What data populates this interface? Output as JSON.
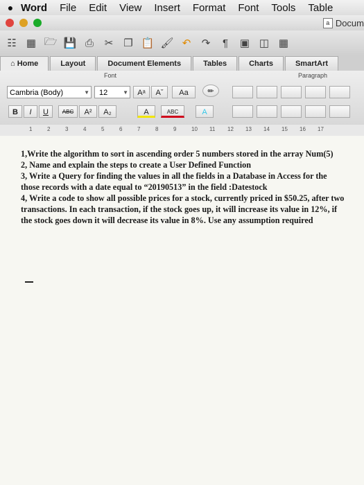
{
  "menubar": {
    "app_name": "Word",
    "items": [
      "File",
      "Edit",
      "View",
      "Insert",
      "Format",
      "Font",
      "Tools",
      "Table"
    ]
  },
  "window": {
    "document_title": "Docum",
    "doc_icon_glyph": "a"
  },
  "ribbon": {
    "tabs": [
      {
        "label": "Home",
        "active": true
      },
      {
        "label": "Layout",
        "active": false
      },
      {
        "label": "Document Elements",
        "active": false
      },
      {
        "label": "Tables",
        "active": false
      },
      {
        "label": "Charts",
        "active": false
      },
      {
        "label": "SmartArt",
        "active": false
      }
    ],
    "font_group_label": "Font",
    "paragraph_group_label": "Paragraph",
    "font_name": "Cambria (Body)",
    "font_size": "12",
    "buttons": {
      "grow": "Aᵃ",
      "shrink": "Aˇ",
      "case": "Aa",
      "bold": "B",
      "italic": "I",
      "underline": "U",
      "strike": "ABC",
      "superscript": "A²",
      "subscript": "A₂",
      "highlight": "ABC",
      "color": "A",
      "effects": "A"
    }
  },
  "ruler": {
    "numbers": [
      "1",
      "2",
      "3",
      "4",
      "5",
      "6",
      "7",
      "8",
      "9",
      "10",
      "11",
      "12",
      "13",
      "14",
      "15",
      "16",
      "17"
    ]
  },
  "document": {
    "paragraphs": [
      "1,Write the algorithm to sort in ascending order 5 numbers stored in the array Num(5)",
      "2, Name and explain the steps to create a User Defined Function",
      "3, Write a Query for finding the values in all the fields in a Database in Access for the those records with a date equal to “20190513” in the field :Datestock",
      "4, Write a code to show all possible prices for a stock, currently priced in $50.25, after two transactions. In each transaction, if the stock goes up, it will increase its value in 12%, if the stock goes down it will decrease its value in 8%. Use any assumption required"
    ]
  },
  "colors": {
    "close": "#e0443e",
    "minimize": "#dea123",
    "zoom": "#1aab29",
    "highlight_yellow": "#f2e600",
    "font_red": "#d0021b",
    "effects_cyan": "#35c7e8"
  }
}
